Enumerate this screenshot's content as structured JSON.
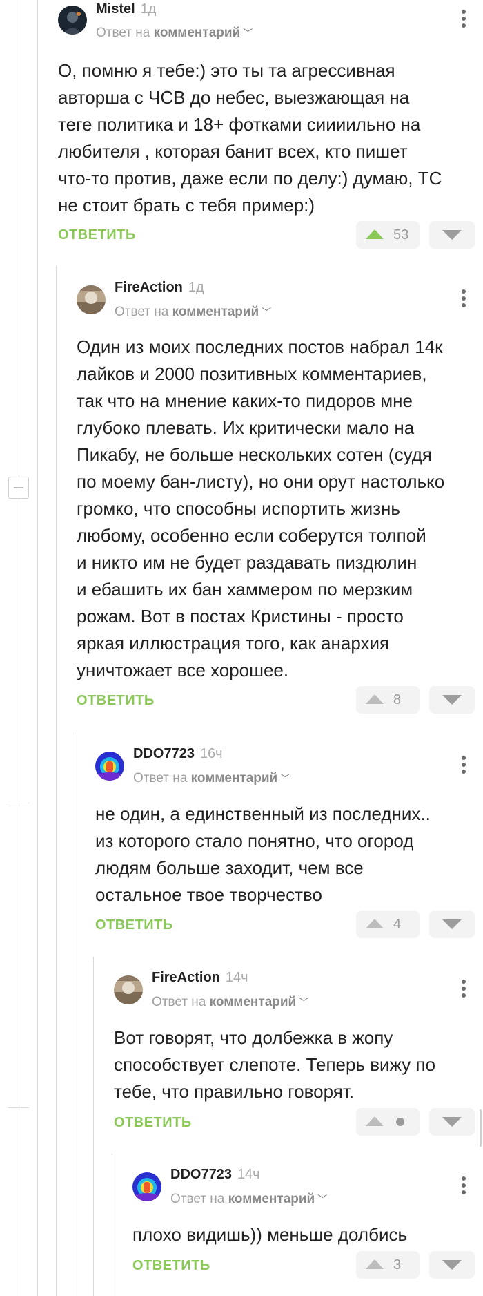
{
  "ui": {
    "reply_prefix": "Ответ на",
    "reply_target": "комментарий",
    "reply_button": "ОТВЕТИТЬ"
  },
  "colors": {
    "accent": "#8ac858",
    "meta": "#a0a0a0"
  },
  "comments": [
    {
      "author": "Mistel",
      "time": "1д",
      "text": [
        "О, помню я тебе:) это ты та агрессивная",
        "авторша с ЧСВ до небес, выезжающая на",
        "теге политика и 18+ фотками сиииильно на",
        "любителя , которая банит всех, кто пишет",
        "что-то против, даже если по делу:) думаю, ТС",
        "не стоит брать с тебя пример:)"
      ],
      "rating": "53",
      "avatar_icon": "dark-avatar-icon"
    },
    {
      "author": "FireAction",
      "time": "1д",
      "text": [
        "Один из моих последних постов набрал 14к",
        "лайков и 2000 позитивных комментариев,",
        "так что на мнение каких-то пидоров мне",
        "глубоко плевать. Их критически мало на",
        "Пикабу, не больше нескольких сотен (судя",
        "по моему бан-листу), но они орут настолько",
        "громко, что способны испортить жизнь",
        "любому, особенно если соберутся толпой",
        "и никто им не будет раздавать пиздюлин",
        "и ебашить их бан хаммером по мерзким",
        "рожам. Вот в постах Кристины - просто",
        "яркая иллюстрация того, как анархия",
        "уничтожает все хорошее."
      ],
      "rating": "8",
      "avatar_icon": "sepia-avatar-icon"
    },
    {
      "author": "DDO7723",
      "time": "16ч",
      "text": [
        "не один, а единственный из последних..",
        "из которого стало понятно, что огород",
        "людям больше заходит, чем все",
        "остальное твое творчество"
      ],
      "rating": "4",
      "avatar_icon": "thermal-avatar-icon"
    },
    {
      "author": "FireAction",
      "time": "14ч",
      "text": [
        "Вот говорят, что долбежка в жопу",
        "способствует слепоте. Теперь вижу по",
        "тебе, что правильно говорят."
      ],
      "rating": "",
      "avatar_icon": "sepia-avatar-icon"
    },
    {
      "author": "DDO7723",
      "time": "14ч",
      "text": [
        "плохо видишь)) меньше долбись"
      ],
      "rating": "3",
      "avatar_icon": "thermal-avatar-icon"
    }
  ]
}
